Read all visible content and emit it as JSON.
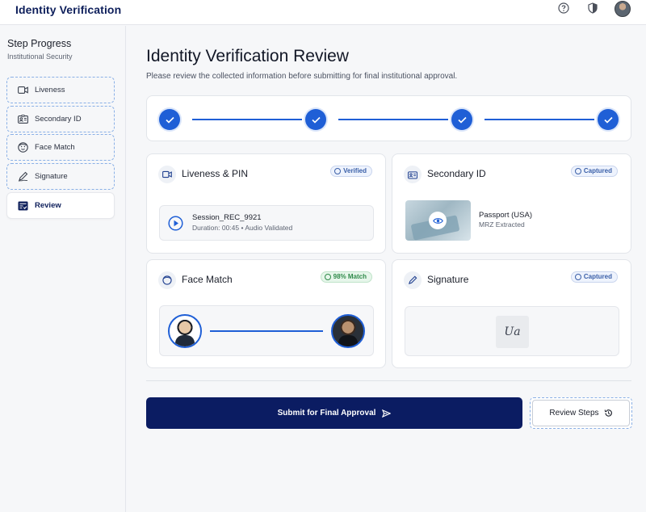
{
  "header": {
    "app_title": "Identity Verification"
  },
  "sidebar": {
    "title": "Step Progress",
    "subtitle": "Institutional Security",
    "items": [
      {
        "label": "Liveness",
        "icon": "video-icon"
      },
      {
        "label": "Secondary ID",
        "icon": "id-card-icon"
      },
      {
        "label": "Face Match",
        "icon": "face-icon"
      },
      {
        "label": "Signature",
        "icon": "signature-icon"
      },
      {
        "label": "Review",
        "icon": "review-icon",
        "active": true
      }
    ]
  },
  "main": {
    "title": "Identity Verification Review",
    "subtitle": "Please review the collected information before submitting for final institutional approval."
  },
  "cards": {
    "liveness": {
      "title": "Liveness & PIN",
      "badge": "Verified",
      "session_name": "Session_REC_9921",
      "session_meta": "Duration: 00:45 • Audio Validated"
    },
    "secondary": {
      "title": "Secondary ID",
      "badge": "Captured",
      "doc_name": "Passport (USA)",
      "doc_meta": "MRZ Extracted"
    },
    "face": {
      "title": "Face Match",
      "badge": "98% Match"
    },
    "signature": {
      "title": "Signature",
      "badge": "Captured",
      "sig_text": "Ua"
    }
  },
  "actions": {
    "submit_label": "Submit for Final Approval",
    "review_label": "Review Steps"
  },
  "colors": {
    "primary": "#1f5fd6",
    "navy": "#0b1c62",
    "success": "#2f8a4a"
  }
}
